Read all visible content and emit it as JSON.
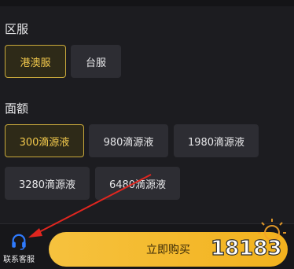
{
  "region": {
    "title": "区服",
    "options": [
      {
        "label": "港澳服",
        "selected": true
      },
      {
        "label": "台服",
        "selected": false
      }
    ]
  },
  "denomination": {
    "title": "面额",
    "options": [
      {
        "label": "300滴源液",
        "selected": true
      },
      {
        "label": "980滴源液",
        "selected": false
      },
      {
        "label": "1980滴源液",
        "selected": false
      },
      {
        "label": "3280滴源液",
        "selected": false
      },
      {
        "label": "6480滴源液",
        "selected": false
      }
    ]
  },
  "footer": {
    "support_label": "联系客服",
    "support_icon": "headset-icon",
    "buy_label": "立即购买"
  },
  "watermark": {
    "text": "18183"
  },
  "colors": {
    "accent": "#f2c94c",
    "buy_button": "#f4b92c",
    "support_icon": "#2f7bff",
    "annotation_arrow": "#e0261f"
  }
}
